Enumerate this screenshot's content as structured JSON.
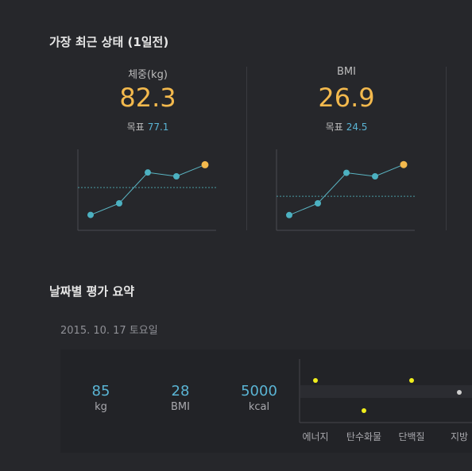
{
  "recent": {
    "title": "가장 최근 상태 (1일전)",
    "cards": [
      {
        "label": "체중(kg)",
        "value": "82.3",
        "goal_label": "목표",
        "goal_value": "77.1",
        "trend": [
          70,
          73,
          81,
          80,
          83
        ],
        "goal_line": 77.1,
        "y_range": [
          66,
          87
        ]
      },
      {
        "label": "BMI",
        "value": "26.9",
        "goal_label": "목표",
        "goal_value": "24.5",
        "trend": [
          22.9,
          23.9,
          26.5,
          26.2,
          27.2
        ],
        "goal_line": 24.5,
        "y_range": [
          21.6,
          28.5
        ]
      }
    ]
  },
  "summary": {
    "title": "날짜별 평가 요약",
    "date": "2015. 10. 17 토요일",
    "metrics": [
      {
        "value": "85",
        "unit": "kg"
      },
      {
        "value": "28",
        "unit": "BMI"
      },
      {
        "value": "5000",
        "unit": "kcal"
      }
    ],
    "nutrients": {
      "categories": [
        "에너지",
        "탄수화물",
        "단백질",
        "지방"
      ],
      "levels": [
        "high",
        "low",
        "high",
        "normal"
      ]
    }
  },
  "colors": {
    "accent_value": "#f3b94d",
    "accent_blue": "#5ab4d4",
    "trend_line": "#5bb7c5",
    "point_latest": "#f3b94d",
    "point_normal": "#4cb1c1",
    "nutrient_flag": "#f0ee1c",
    "nutrient_normal": "#cfcfcf"
  }
}
